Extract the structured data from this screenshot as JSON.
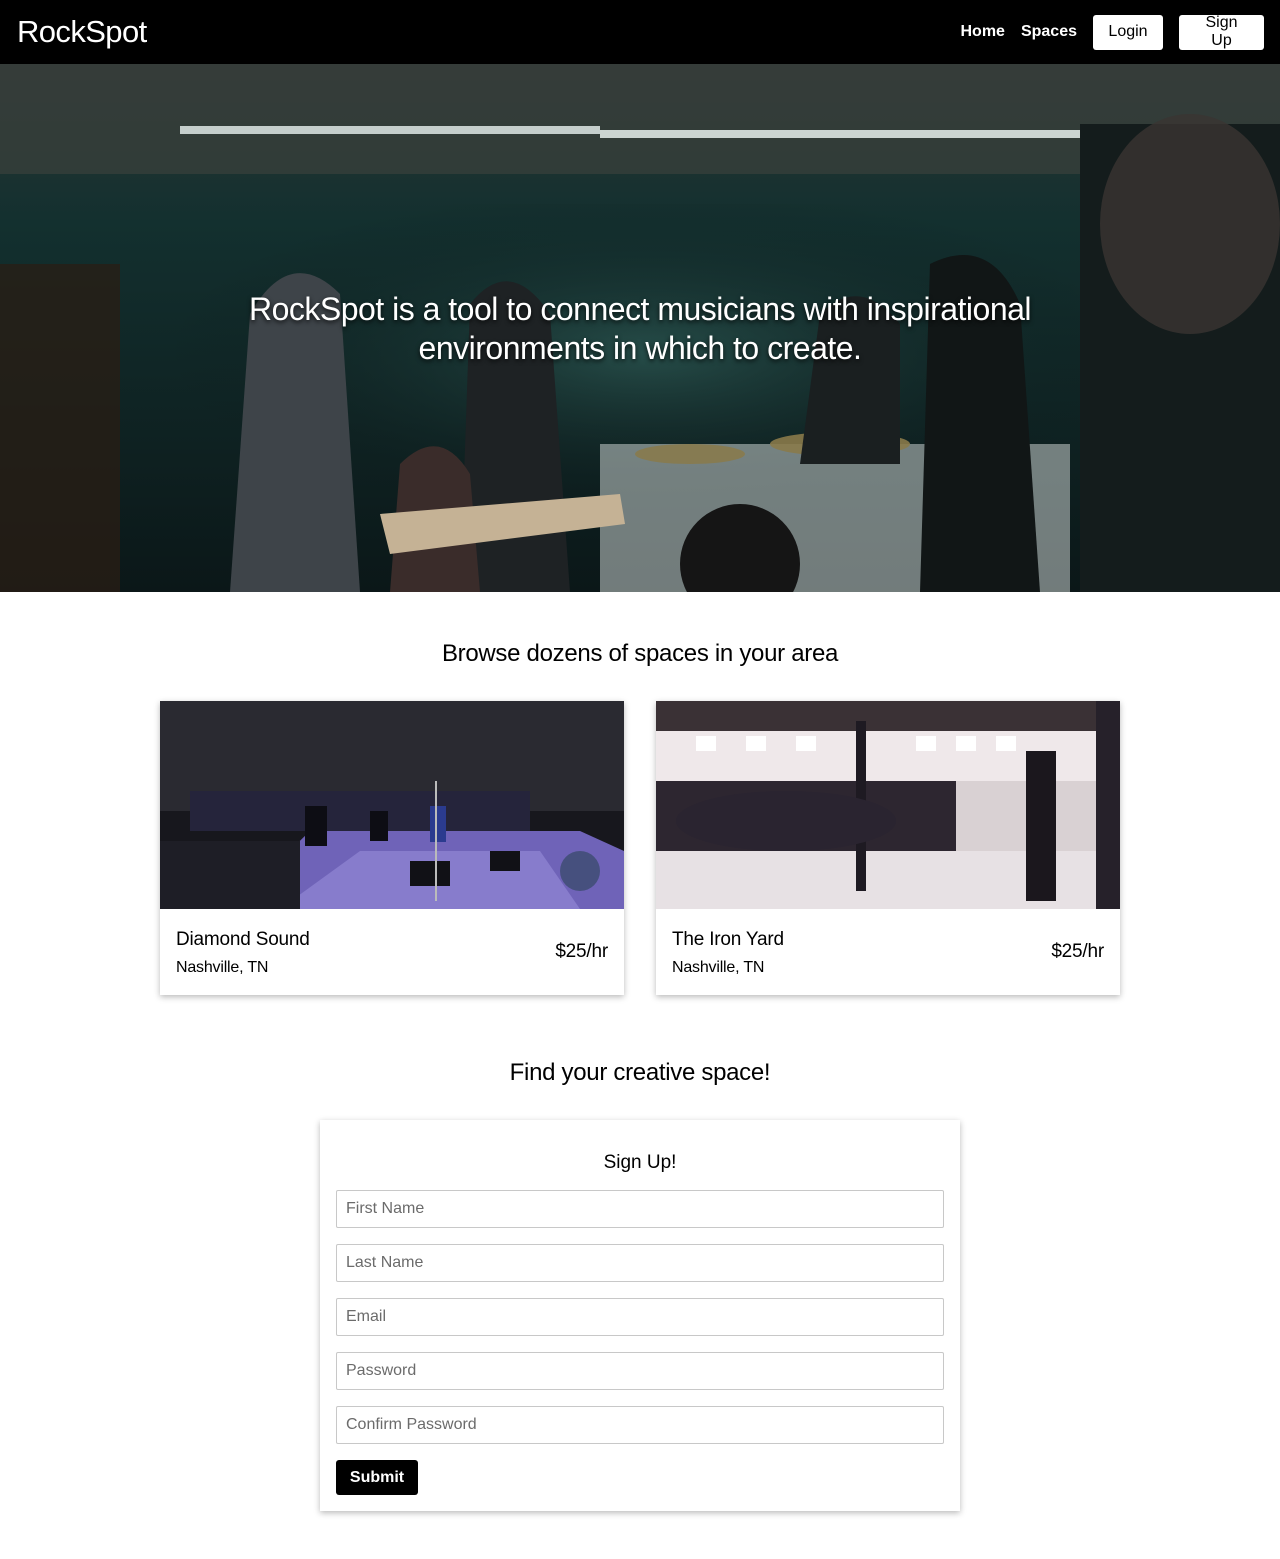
{
  "nav": {
    "brand": "RockSpot",
    "links": [
      "Home",
      "Spaces"
    ],
    "login_label": "Login",
    "signup_label": "Sign Up"
  },
  "hero": {
    "tagline_line1": "RockSpot is a tool to connect musicians with inspirational",
    "tagline_line2": "environments in which to create."
  },
  "browse": {
    "title": "Browse dozens of spaces in your area",
    "spaces": [
      {
        "name": "Diamond Sound",
        "location": "Nashville, TN",
        "price": "$25/hr"
      },
      {
        "name": "The Iron Yard",
        "location": "Nashville, TN",
        "price": "$25/hr"
      }
    ]
  },
  "signup": {
    "section_title": "Find your creative space!",
    "form_title": "Sign Up!",
    "fields": {
      "first_name": "First Name",
      "last_name": "Last Name",
      "email": "Email",
      "password": "Password",
      "confirm_password": "Confirm Password"
    },
    "submit_label": "Submit"
  }
}
